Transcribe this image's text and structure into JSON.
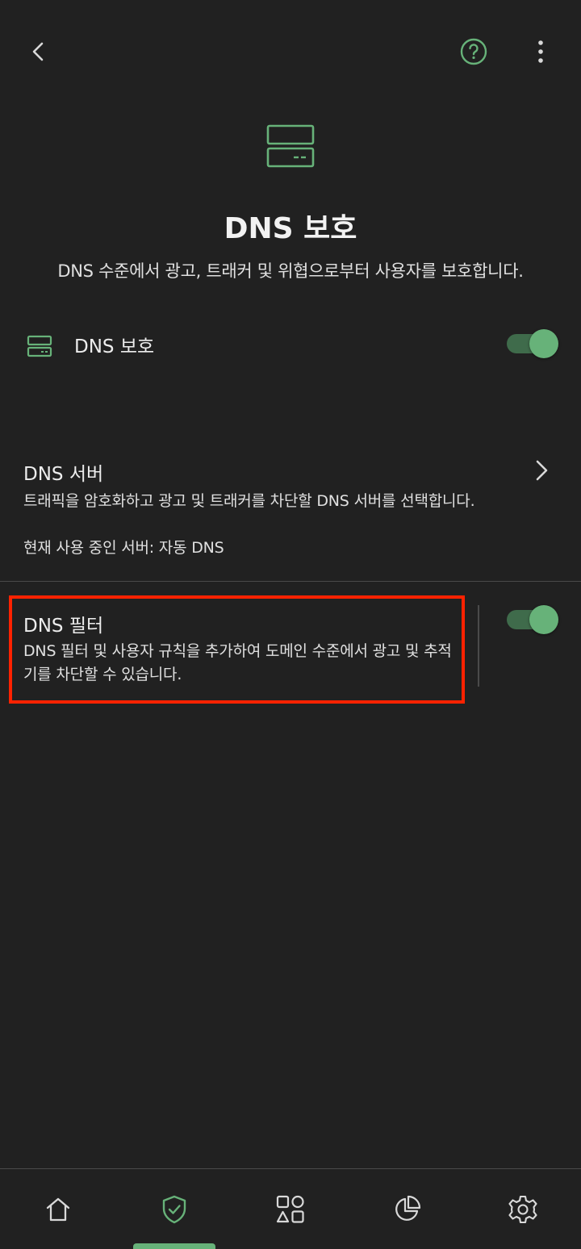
{
  "header": {
    "title": "DNS 보호",
    "subtitle": "DNS 수준에서 광고, 트래커 및 위협으로부터 사용자를 보호합니다."
  },
  "icons": {
    "back": "back-arrow-icon",
    "help": "help-icon",
    "more": "more-vertical-icon",
    "hero": "server-icon"
  },
  "dns_protection": {
    "label": "DNS 보호",
    "enabled": true
  },
  "dns_server": {
    "title": "DNS 서버",
    "description": "트래픽을 암호화하고 광고 및 트래커를 차단할 DNS 서버를 선택합니다.",
    "current": "현재 사용 중인 서버: 자동 DNS"
  },
  "dns_filter": {
    "title": "DNS 필터",
    "description": "DNS 필터 및 사용자 규칙을 추가하여 도메인 수준에서 광고 및 추적기를 차단할 수 있습니다.",
    "enabled": true
  },
  "bottom_nav": {
    "items": [
      "home",
      "protection",
      "apps",
      "statistics",
      "settings"
    ],
    "active": "protection"
  },
  "colors": {
    "accent": "#67b279",
    "background": "#212121",
    "highlight": "#ff2200"
  }
}
